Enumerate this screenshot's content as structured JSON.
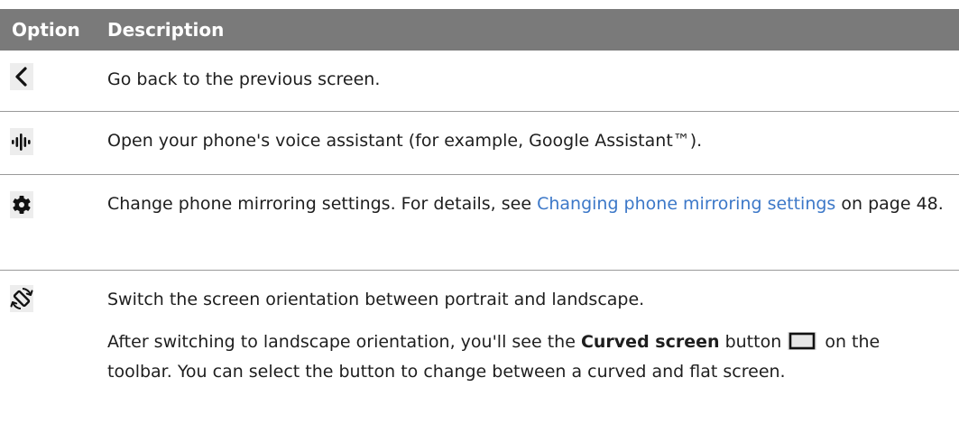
{
  "header": {
    "option": "Option",
    "description": "Description"
  },
  "rows": [
    {
      "icon": "chevron-left-icon",
      "description": "Go back to the previous screen."
    },
    {
      "icon": "voice-assistant-icon",
      "description": "Open your phone's voice assistant (for example, Google Assistant™)."
    },
    {
      "icon": "gear-icon",
      "description_before": "Change phone mirroring settings. For details, see ",
      "link_text": "Changing phone mirroring settings",
      "description_after": " on page 48."
    },
    {
      "icon": "rotate-screen-icon",
      "description": "Switch the screen orientation between portrait and landscape.",
      "note_before": "After switching to landscape orientation, you'll see the ",
      "note_bold": "Curved screen",
      "note_mid": " button",
      "note_icon": "curved-screen-icon",
      "note_after": " on the toolbar. You can select the button to change between a curved and flat screen."
    }
  ]
}
